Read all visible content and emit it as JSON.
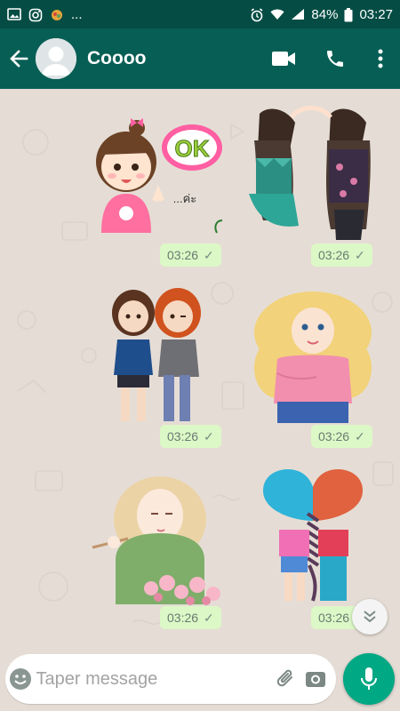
{
  "status_bar": {
    "left_dots": "...",
    "battery_percent": "84%",
    "time": "03:27"
  },
  "header": {
    "contact_name": "Coooo"
  },
  "messages": [
    {
      "sticker": "girl-ok-sticker",
      "time": "03:26",
      "status": "read-tick",
      "sticker_text": "OK",
      "sticker_subtext": "...ค่ะ"
    },
    {
      "sticker": "two-girls-heart-sticker",
      "time": "03:26",
      "status": "read-tick"
    },
    {
      "sticker": "two-friends-sticker",
      "time": "03:26",
      "status": "read-tick"
    },
    {
      "sticker": "blonde-girl-sticker",
      "time": "03:26",
      "status": "read-tick"
    },
    {
      "sticker": "girl-flowers-sticker",
      "time": "03:26",
      "status": "read-tick"
    },
    {
      "sticker": "braided-heart-sticker",
      "time": "03:26",
      "status": "read-tick"
    }
  ],
  "composer": {
    "placeholder": "Taper message"
  },
  "colors": {
    "header": "#075e54",
    "status_bar": "#054d44",
    "bubble": "#dcf8c6",
    "mic": "#00a884",
    "chat_bg": "#e5ddd5"
  }
}
